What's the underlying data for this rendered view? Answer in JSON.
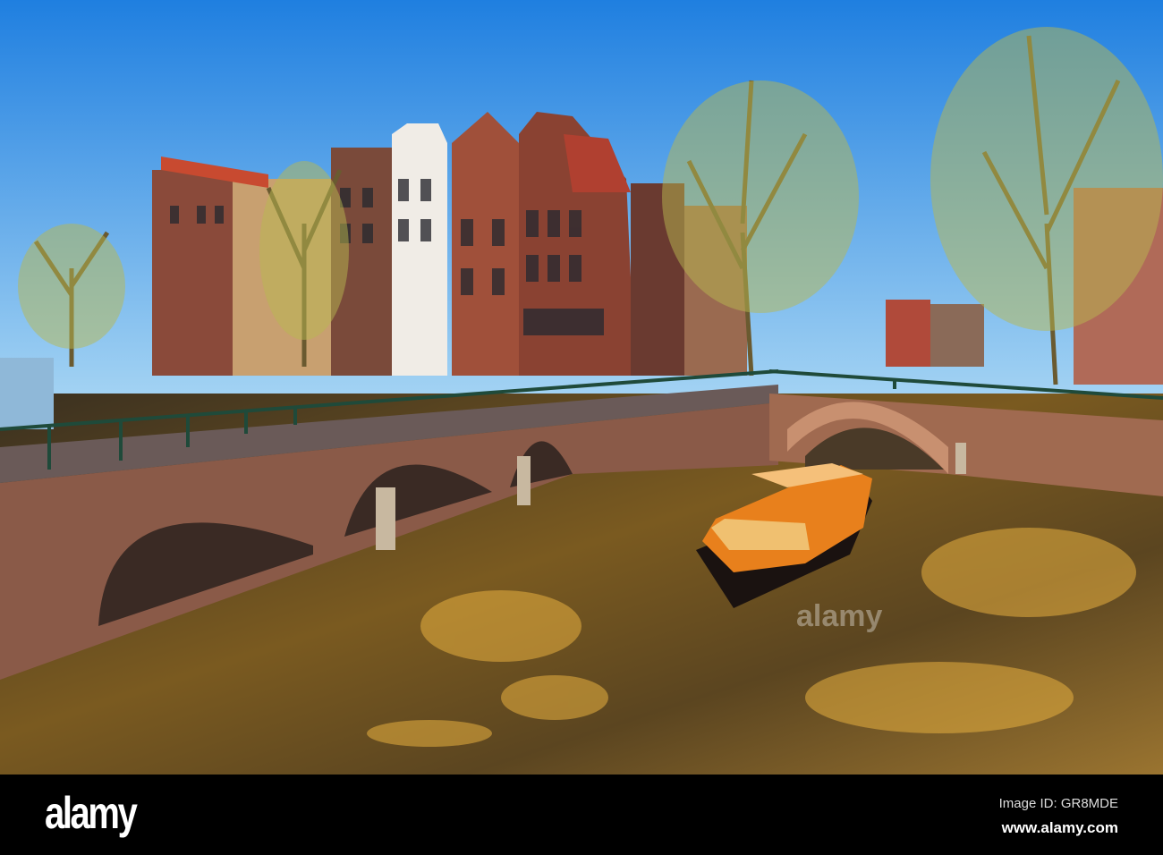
{
  "photo": {
    "subject": "Amsterdam canal with bridges and tour boat"
  },
  "footer": {
    "logo": "alamy",
    "image_id": "Image ID: GR8MDE",
    "website": "www.alamy.com"
  },
  "watermark": "alamy",
  "colors": {
    "sky_top": "#1f7fe0",
    "sky_bottom": "#9cd0f2",
    "water": "#4a3a1c",
    "boat": "#e8801c",
    "brick": "#8a5a48"
  }
}
